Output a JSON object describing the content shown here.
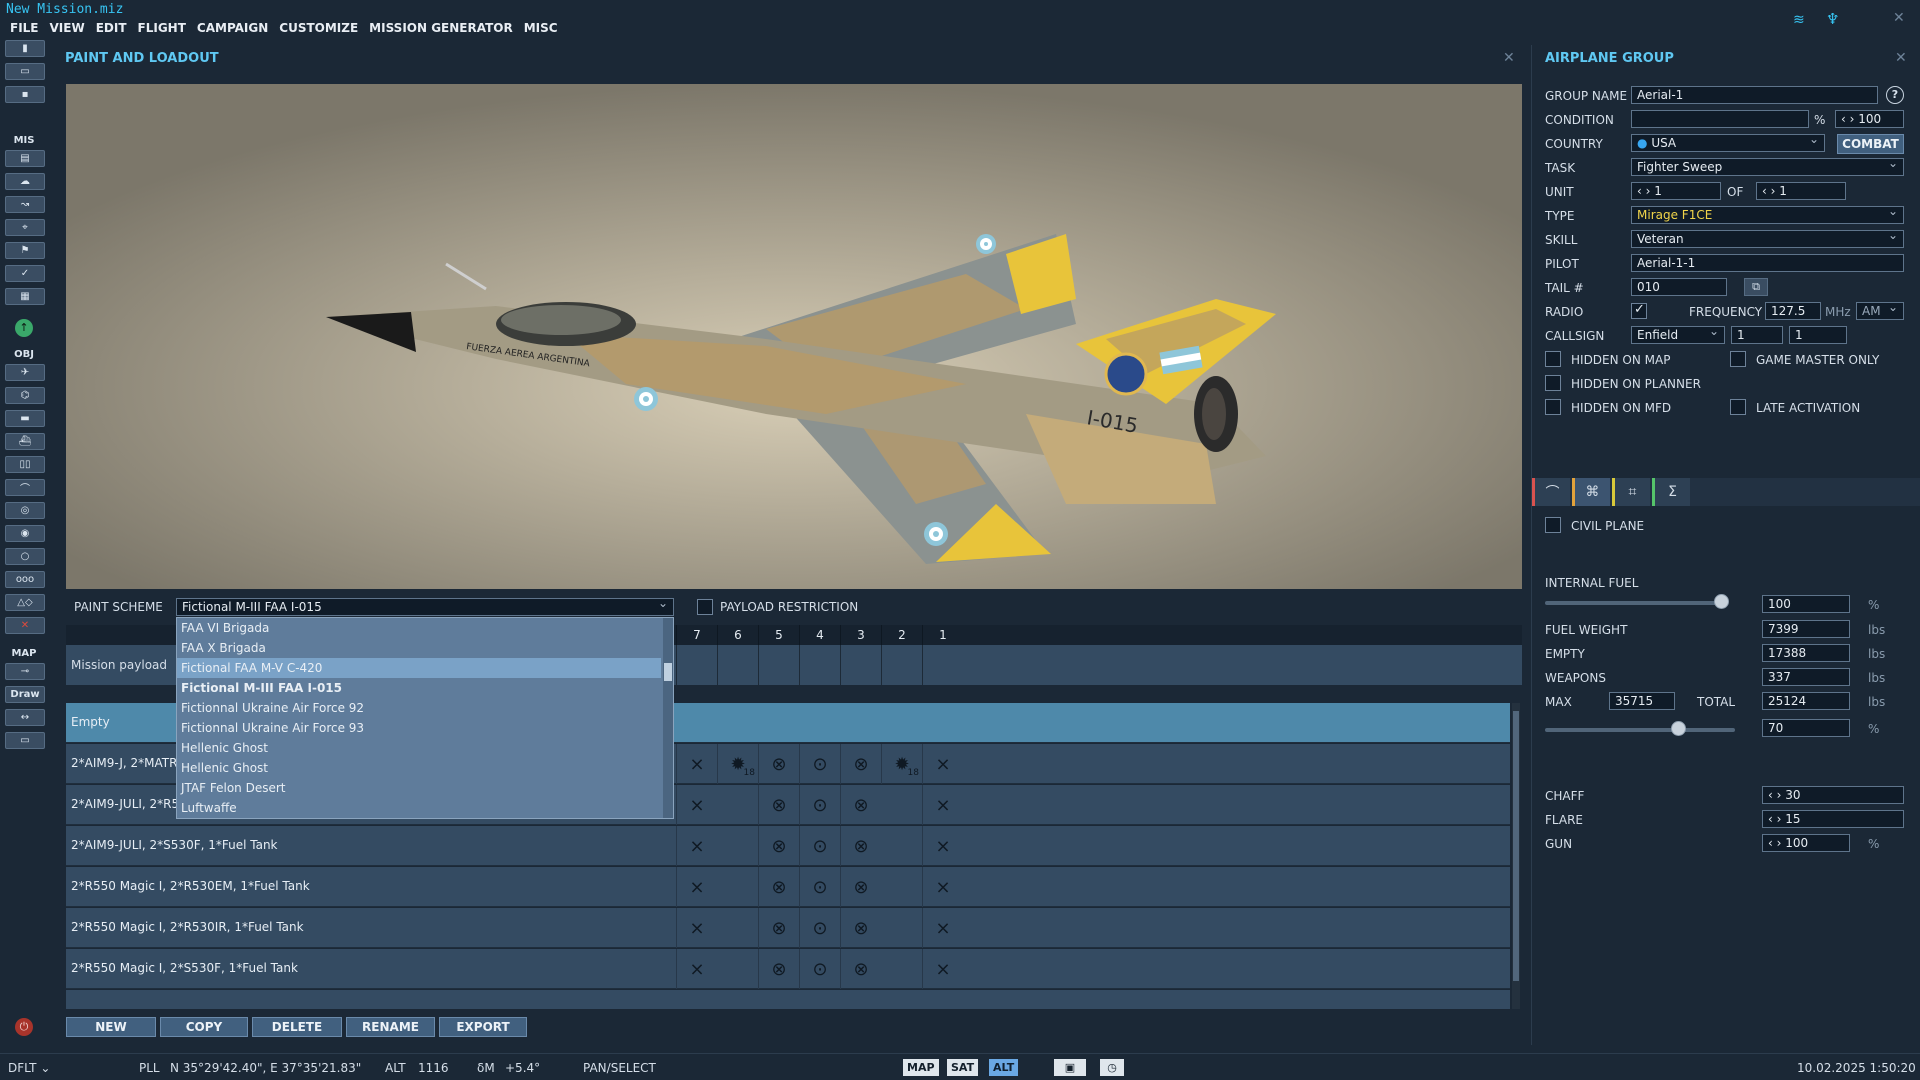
{
  "window": {
    "title": "New Mission.miz"
  },
  "menu": [
    "FILE",
    "VIEW",
    "EDIT",
    "FLIGHT",
    "CAMPAIGN",
    "CUSTOMIZE",
    "MISSION GENERATOR",
    "MISC"
  ],
  "left_toolbar": {
    "mis_label": "MIS",
    "obj_label": "OBJ",
    "map_label": "MAP",
    "draw_label": "Draw"
  },
  "paint_panel": {
    "title": "PAINT AND LOADOUT",
    "paint_scheme_label": "PAINT SCHEME",
    "paint_scheme_value": "Fictional M-III FAA I-015",
    "payload_restriction_label": "PAYLOAD RESTRICTION",
    "paint_options": [
      "FAA VI Brigada",
      "FAA X Brigada",
      "Fictional FAA M-V C-420",
      "Fictional M-III FAA I-015",
      "Fictionnal Ukraine Air Force 92",
      "Fictionnal Ukraine Air Force 93",
      "Hellenic Ghost",
      "Hellenic Ghost",
      "JTAF Felon Desert",
      "Luftwaffe"
    ],
    "paint_highlighted_index": 2,
    "paint_selected_index": 3,
    "slot_numbers": [
      "7",
      "6",
      "5",
      "4",
      "3",
      "2",
      "1"
    ],
    "mission_payload_label": "Mission payload",
    "payload_rows": [
      {
        "name": "Empty",
        "selected": true
      },
      {
        "name": "2*AIM9-J, 2*MATRA"
      },
      {
        "name": "2*AIM9-JULI, 2*R53"
      },
      {
        "name": "2*AIM9-JULI, 2*S530F, 1*Fuel Tank"
      },
      {
        "name": "2*R550 Magic I, 2*R530EM, 1*Fuel Tank"
      },
      {
        "name": "2*R550 Magic I, 2*R530IR, 1*Fuel Tank"
      },
      {
        "name": "2*R550 Magic I, 2*S530F, 1*Fuel Tank"
      }
    ],
    "row_badge": "18",
    "buttons": {
      "new": "NEW",
      "copy": "COPY",
      "delete": "DELETE",
      "rename": "RENAME",
      "export": "EXPORT"
    }
  },
  "aircraft_livery": {
    "roundel_color": "#8ec6d9",
    "camo_tan": "#b59a6a",
    "camo_grey": "#8b9290",
    "tail_yellow": "#e8c43a",
    "marking_text": "FUERZA AEREA ARGENTINA",
    "serial": "I-015"
  },
  "group_panel": {
    "title": "AIRPLANE GROUP",
    "labels": {
      "group_name": "GROUP NAME",
      "condition": "CONDITION",
      "country": "COUNTRY",
      "task": "TASK",
      "unit": "UNIT",
      "of": "OF",
      "type": "TYPE",
      "skill": "SKILL",
      "pilot": "PILOT",
      "tail": "TAIL #",
      "radio": "RADIO",
      "frequency": "FREQUENCY",
      "callsign": "CALLSIGN",
      "mhz": "MHz",
      "percent": "%"
    },
    "values": {
      "group_name": "Aerial-1",
      "condition": "",
      "condition_pct": "100",
      "country": "USA",
      "task": "Fighter Sweep",
      "unit": "1",
      "unit_of": "1",
      "type": "Mirage F1CE",
      "skill": "Veteran",
      "pilot": "Aerial-1-1",
      "tail": "010",
      "frequency": "127.5",
      "modulation": "AM",
      "callsign": "Enfield",
      "callsign_n1": "1",
      "callsign_n2": "1"
    },
    "combat_button": "COMBAT",
    "checkboxes": {
      "hidden_on_map": "HIDDEN ON MAP",
      "game_master_only": "GAME MASTER ONLY",
      "hidden_on_planner": "HIDDEN ON PLANNER",
      "hidden_on_mfd": "HIDDEN ON MFD",
      "late_activation": "LATE ACTIVATION",
      "civil_plane": "CIVIL PLANE"
    },
    "tab_colors": [
      "#d9534f",
      "#e2a23b",
      "#d8c93a",
      "#55c46a"
    ],
    "fuel": {
      "internal_fuel_label": "INTERNAL FUEL",
      "internal_fuel": "100",
      "internal_fuel_fraction": 0.98,
      "fuel_weight_label": "FUEL WEIGHT",
      "fuel_weight": "7399",
      "empty_label": "EMPTY",
      "empty": "17388",
      "weapons_label": "WEAPONS",
      "weapons": "337",
      "max_label": "MAX",
      "max": "35715",
      "total_label": "TOTAL",
      "total": "25124",
      "total_pct": "70",
      "total_fraction": 0.7,
      "lbs": "lbs",
      "pct": "%"
    },
    "countermeasures": {
      "chaff_label": "CHAFF",
      "chaff": "30",
      "flare_label": "FLARE",
      "flare": "15",
      "gun_label": "GUN",
      "gun": "100",
      "gun_unit": "%"
    }
  },
  "status_bar": {
    "profile": "DFLT",
    "coord_mode": "PLL",
    "coords": "N 35°29'42.40\", E 37°35'21.83\"",
    "alt_label": "ALT",
    "alt": "1116",
    "dm_label": "δM",
    "dm": "+5.4°",
    "mode": "PAN/SELECT",
    "map_btn": "MAP",
    "sat_btn": "SAT",
    "alt_btn": "ALT",
    "datetime": "10.02.2025 1:50:20"
  }
}
